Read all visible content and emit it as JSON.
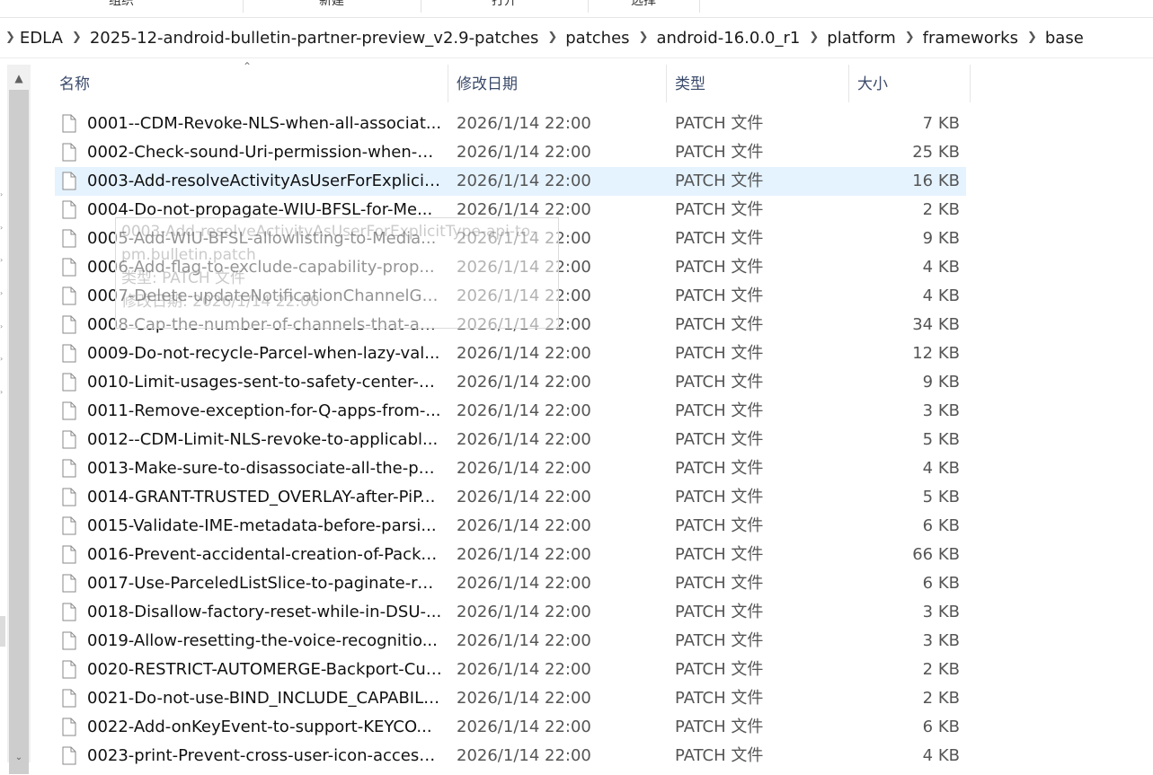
{
  "ribbon": {
    "groups": [
      "组织",
      "新建",
      "打开",
      "选择"
    ]
  },
  "breadcrumb": {
    "items": [
      "EDLA",
      "2025-12-android-bulletin-partner-preview_v2.9-patches",
      "patches",
      "android-16.0.0_r1",
      "platform",
      "frameworks",
      "base"
    ]
  },
  "columns": {
    "name": "名称",
    "date": "修改日期",
    "type": "类型",
    "size": "大小"
  },
  "files": [
    {
      "name": "0001--CDM-Revoke-NLS-when-all-associat...",
      "date": "2026/1/14 22:00",
      "type": "PATCH 文件",
      "size": "7 KB"
    },
    {
      "name": "0002-Check-sound-Uri-permission-when-cr...",
      "date": "2026/1/14 22:00",
      "type": "PATCH 文件",
      "size": "25 KB"
    },
    {
      "name": "0003-Add-resolveActivityAsUserForExplicit...",
      "date": "2026/1/14 22:00",
      "type": "PATCH 文件",
      "size": "16 KB"
    },
    {
      "name": "0004-Do-not-propagate-WIU-BFSL-for-Me...",
      "date": "2026/1/14 22:00",
      "type": "PATCH 文件",
      "size": "2 KB"
    },
    {
      "name": "0005-Add-WIU-BFSL-allowlisting-to-Media...",
      "date": "2026/1/14 22:00",
      "type": "PATCH 文件",
      "size": "9 KB"
    },
    {
      "name": "0006-Add-flag-to-exclude-capability-prop...",
      "date": "2026/1/14 22:00",
      "type": "PATCH 文件",
      "size": "4 KB"
    },
    {
      "name": "0007-Delete-updateNotificationChannelGr...",
      "date": "2026/1/14 22:00",
      "type": "PATCH 文件",
      "size": "4 KB"
    },
    {
      "name": "0008-Cap-the-number-of-channels-that-an...",
      "date": "2026/1/14 22:00",
      "type": "PATCH 文件",
      "size": "34 KB"
    },
    {
      "name": "0009-Do-not-recycle-Parcel-when-lazy-val...",
      "date": "2026/1/14 22:00",
      "type": "PATCH 文件",
      "size": "12 KB"
    },
    {
      "name": "0010-Limit-usages-sent-to-safety-center-b...",
      "date": "2026/1/14 22:00",
      "type": "PATCH 文件",
      "size": "9 KB"
    },
    {
      "name": "0011-Remove-exception-for-Q-apps-from-...",
      "date": "2026/1/14 22:00",
      "type": "PATCH 文件",
      "size": "3 KB"
    },
    {
      "name": "0012--CDM-Limit-NLS-revoke-to-applicabl...",
      "date": "2026/1/14 22:00",
      "type": "PATCH 文件",
      "size": "5 KB"
    },
    {
      "name": "0013-Make-sure-to-disassociate-all-the-pa...",
      "date": "2026/1/14 22:00",
      "type": "PATCH 文件",
      "size": "4 KB"
    },
    {
      "name": "0014-GRANT-TRUSTED_OVERLAY-after-PiP...",
      "date": "2026/1/14 22:00",
      "type": "PATCH 文件",
      "size": "5 KB"
    },
    {
      "name": "0015-Validate-IME-metadata-before-parsi...",
      "date": "2026/1/14 22:00",
      "type": "PATCH 文件",
      "size": "6 KB"
    },
    {
      "name": "0016-Prevent-accidental-creation-of-Packa...",
      "date": "2026/1/14 22:00",
      "type": "PATCH 文件",
      "size": "66 KB"
    },
    {
      "name": "0017-Use-ParceledListSlice-to-paginate-res...",
      "date": "2026/1/14 22:00",
      "type": "PATCH 文件",
      "size": "6 KB"
    },
    {
      "name": "0018-Disallow-factory-reset-while-in-DSU-...",
      "date": "2026/1/14 22:00",
      "type": "PATCH 文件",
      "size": "3 KB"
    },
    {
      "name": "0019-Allow-resetting-the-voice-recognitio...",
      "date": "2026/1/14 22:00",
      "type": "PATCH 文件",
      "size": "3 KB"
    },
    {
      "name": "0020-RESTRICT-AUTOMERGE-Backport-Cut...",
      "date": "2026/1/14 22:00",
      "type": "PATCH 文件",
      "size": "2 KB"
    },
    {
      "name": "0021-Do-not-use-BIND_INCLUDE_CAPABILI...",
      "date": "2026/1/14 22:00",
      "type": "PATCH 文件",
      "size": "2 KB"
    },
    {
      "name": "0022-Add-onKeyEvent-to-support-KEYCO...",
      "date": "2026/1/14 22:00",
      "type": "PATCH 文件",
      "size": "6 KB"
    },
    {
      "name": "0023-print-Prevent-cross-user-icon-access....",
      "date": "2026/1/14 22:00",
      "type": "PATCH 文件",
      "size": "4 KB"
    }
  ],
  "selected_index": 2,
  "tooltip": {
    "line1": "0003-Add-resolveActivityAsUserForExplicitType-api-to-",
    "line2": "pm.bulletin.patch",
    "line3": "类型: PATCH 文件",
    "line4": "修改日期: 2026/1/14 22:00"
  },
  "colors": {
    "selection": "#e5f3ff",
    "header_text": "#3a4a6b"
  },
  "icons": {
    "file": "file-icon",
    "breadcrumb_separator": "chevron-right-icon",
    "scroll_up": "chevron-up-icon",
    "scroll_down": "chevron-down-icon",
    "sort": "sort-ascending-icon"
  }
}
